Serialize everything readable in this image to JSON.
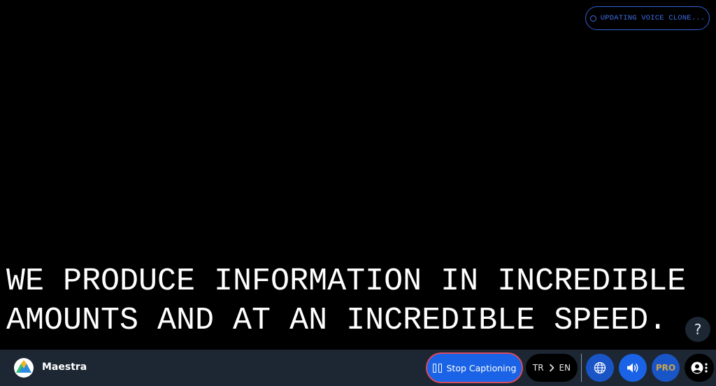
{
  "status": {
    "text": "UPDATING VOICE CLONE...",
    "icon": "spinner-icon"
  },
  "caption": {
    "lines": [
      "WE PRODUCE INFORMATION IN INCREDIBLE",
      "AMOUNTS AND AT AN INCREDIBLE SPEED."
    ]
  },
  "help": {
    "label": "?"
  },
  "toolbar": {
    "brand_name": "Maestra",
    "stop_label": "Stop Captioning",
    "source_lang": "TR",
    "target_lang": "EN",
    "pro_label": "PRO"
  },
  "colors": {
    "accent": "#1a63e6",
    "toolbar_bg": "#1c2733",
    "status_blue": "#3f6fe6",
    "pro_gold": "#c9a64a"
  }
}
